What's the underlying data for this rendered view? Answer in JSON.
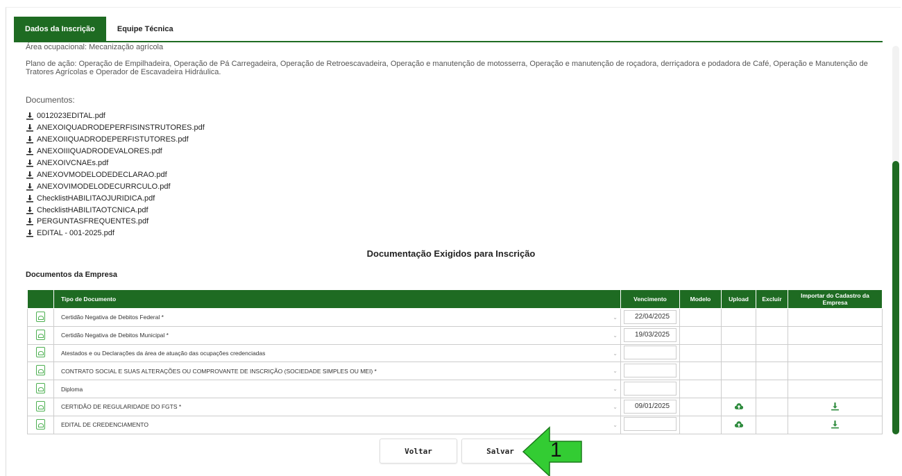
{
  "tabs": [
    {
      "label": "Dados da Inscrição",
      "active": true
    },
    {
      "label": "Equipe Técnica",
      "active": false
    }
  ],
  "info": {
    "area": "Área ocupacional: Mecanização agrícola",
    "plano": "Plano de ação: Operação de Empilhadeira, Operação de Pá Carregadeira, Operação de Retroescavadeira, Operação e manutenção de motosserra, Operação e manutenção de roçadora, derriçadora e podadora de Café, Operação e Manutenção de Tratores Agrícolas e Operador de Escavadeira Hidráulica.",
    "documentos_label": "Documentos:"
  },
  "documents": [
    "0012023EDITAL.pdf",
    "ANEXOIQUADRODEPERFISINSTRUTORES.pdf",
    "ANEXOIIQUADRODEPERFISTUTORES.pdf",
    "ANEXOIIIQUADRODEVALORES.pdf",
    "ANEXOIVCNAEs.pdf",
    "ANEXOVMODELODEDECLARAO.pdf",
    "ANEXOVIMODELODECURRCULO.pdf",
    "ChecklistHABILITAOJURIDICA.pdf",
    "ChecklistHABILITAOTCNICA.pdf",
    "PERGUNTASFREQUENTES.pdf",
    "EDITAL - 001-2025.pdf"
  ],
  "section_title": "Documentação Exigidos para Inscrição",
  "empresa_title": "Documentos da Empresa",
  "table": {
    "headers": {
      "tipo": "Tipo de Documento",
      "vencimento": "Vencimento",
      "modelo": "Modelo",
      "upload": "Upload",
      "excluir": "Excluir",
      "importar": "Importar do Cadastro da Empresa"
    },
    "rows": [
      {
        "tipo": "Certidão Negativa de Debitos Federal *",
        "vencimento": "22/04/2025",
        "upload": false,
        "importar": false
      },
      {
        "tipo": "Certidão Negativa de Debitos Municipal *",
        "vencimento": "19/03/2025",
        "upload": false,
        "importar": false
      },
      {
        "tipo": "Atestados e ou Declarações da área de atuação das ocupações credenciadas",
        "vencimento": "",
        "upload": false,
        "importar": false
      },
      {
        "tipo": "CONTRATO SOCIAL E SUAS ALTERAÇÕES OU COMPROVANTE DE INSCRIÇÃO (SOCIEDADE SIMPLES OU MEI) *",
        "vencimento": "",
        "upload": false,
        "importar": false
      },
      {
        "tipo": "Diploma",
        "vencimento": "",
        "upload": false,
        "importar": false
      },
      {
        "tipo": "CERTIDÃO DE REGULARIDADE DO FGTS *",
        "vencimento": "09/01/2025",
        "upload": true,
        "importar": true
      },
      {
        "tipo": "EDITAL DE CREDENCIAMENTO",
        "vencimento": "",
        "upload": true,
        "importar": true
      }
    ]
  },
  "buttons": {
    "voltar": "Voltar",
    "salvar": "Salvar"
  },
  "callout": {
    "number": "1",
    "color": "#33cc33"
  },
  "colors": {
    "primary": "#1e6b22",
    "icon_green": "#4caf50"
  }
}
